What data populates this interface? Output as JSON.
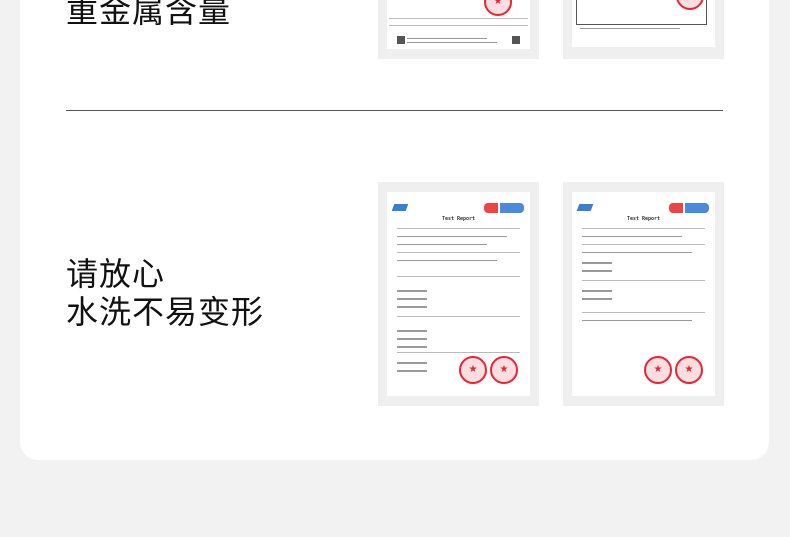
{
  "section_top": {
    "heading": "重金属含量"
  },
  "section_bottom": {
    "heading_line1": "请放心",
    "heading_line2": "水洗不易变形"
  },
  "reports": [
    {
      "title": "Test Report"
    },
    {
      "title": "Test Report"
    }
  ],
  "colors": {
    "stamp": "#e22233",
    "background": "#f2f2f2"
  }
}
